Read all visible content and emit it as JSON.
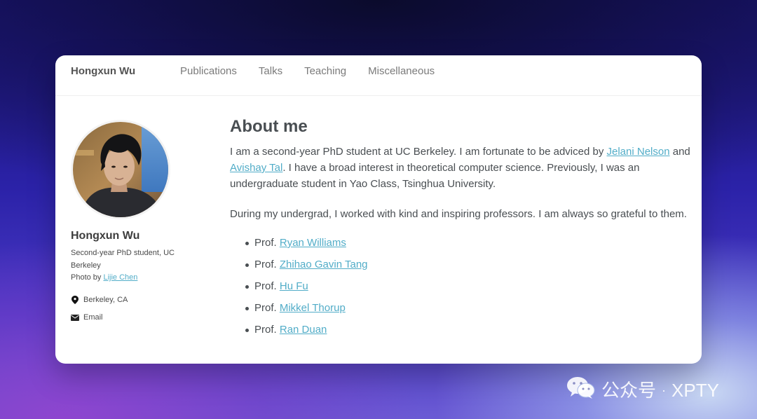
{
  "navbar": {
    "site_title": "Hongxun Wu",
    "links": [
      "Publications",
      "Talks",
      "Teaching",
      "Miscellaneous"
    ]
  },
  "sidebar": {
    "name": "Hongxun Wu",
    "bio_line": "Second-year PhD student, UC Berkeley",
    "photo_prefix": "Photo by ",
    "photo_credit": "Lijie Chen",
    "location": "Berkeley, CA",
    "email_label": "Email",
    "icons": {
      "location": "map-marker-icon",
      "email": "envelope-icon"
    }
  },
  "main": {
    "heading": "About me",
    "para1": {
      "t1": "I am a second-year PhD student at UC Berkeley. I am fortunate to be adviced by ",
      "link1": "Jelani Nelson",
      "t2": " and ",
      "link2": "Avishay Tal",
      "t3": ". I have a broad interest in theoretical computer science. Previously, I was an undergraduate student in Yao Class, Tsinghua University."
    },
    "para2": "During my undergrad, I worked with kind and inspiring professors. I am always so grateful to them.",
    "prof_prefix": "Prof. ",
    "professors": [
      "Ryan Williams",
      "Zhihao Gavin Tang",
      "Hu Fu",
      "Mikkel Thorup",
      "Ran Duan"
    ]
  },
  "watermark": {
    "text": "公众号",
    "separator": "·",
    "brand": "XPTY",
    "icon": "wechat-icon"
  },
  "colors": {
    "link": "#52adc8",
    "text": "#494e52",
    "nav": "#7a7a7a"
  }
}
